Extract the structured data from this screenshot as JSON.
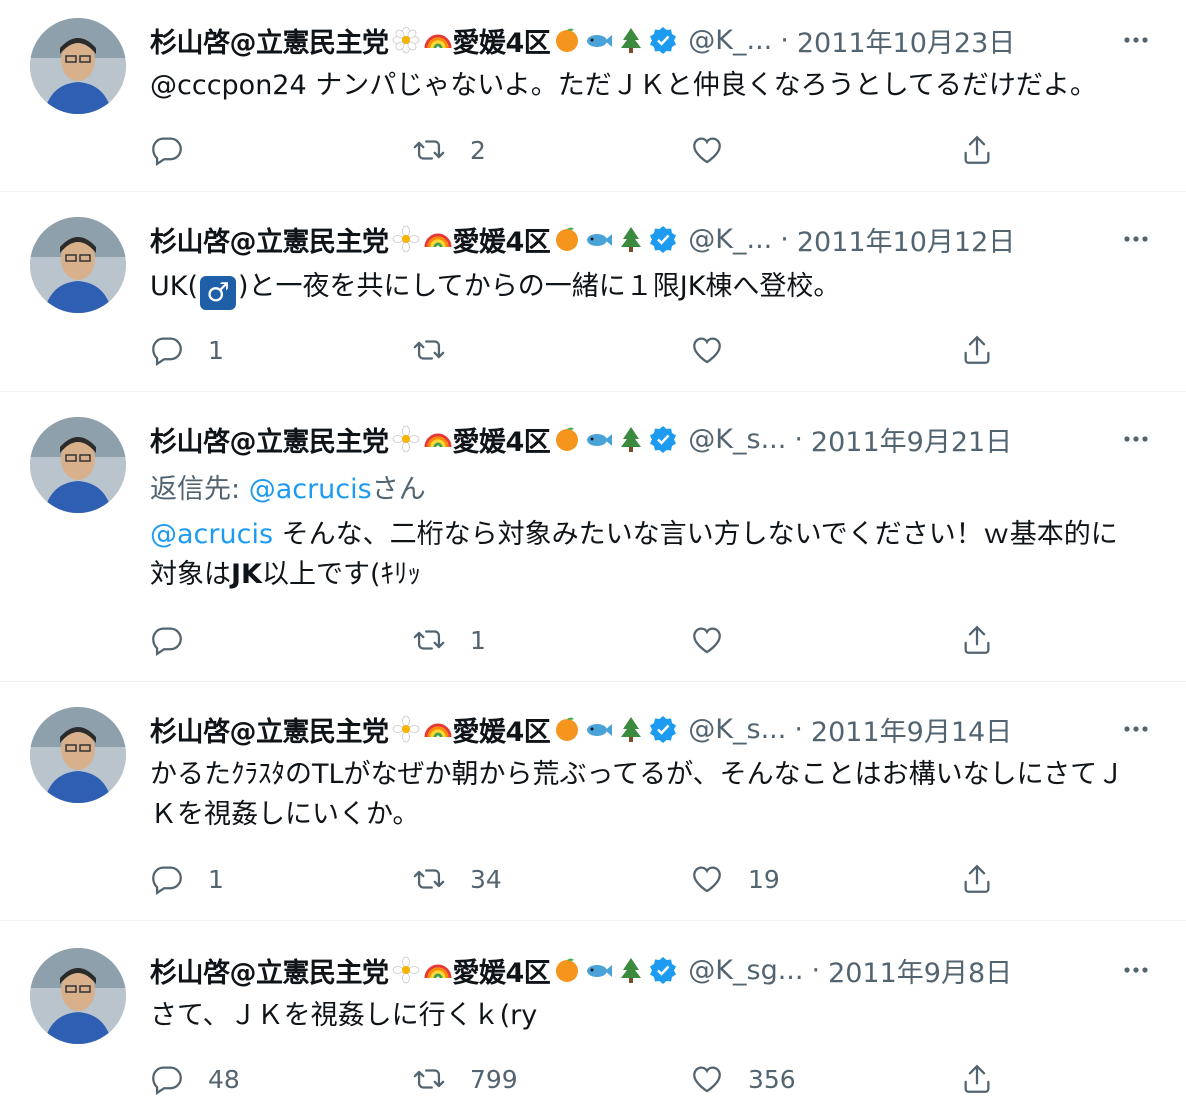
{
  "author": {
    "name": "杉山啓@立憲民主党",
    "emojis": [
      "daisy-icon",
      "rainbow-icon"
    ],
    "suffix": "愛媛4区",
    "suffix_emojis": [
      "orange-icon",
      "fish-icon",
      "tree-icon",
      "verified-badge-icon"
    ]
  },
  "colors": {
    "link": "#1d9bf0",
    "muted": "#536471",
    "verified": "#1d9bf0"
  },
  "tweets": [
    {
      "handle": "@K_...",
      "date": "2011年10月23日",
      "text_parts": [
        "@cccpon24 ナンパじゃないよ。ただＪＫと仲良くなろうとしてるだけだよ。"
      ],
      "reply_count": "",
      "retweet_count": "2",
      "like_count": ""
    },
    {
      "handle": "@K_...",
      "date": "2011年10月12日",
      "text_pre": "UK(",
      "text_symbol": "♂",
      "text_post": ")と一夜を共にしてからの一緒に１限JK棟へ登校。",
      "reply_count": "1",
      "retweet_count": "",
      "like_count": ""
    },
    {
      "handle": "@K_s...",
      "date": "2011年9月21日",
      "reply_label": "返信先: ",
      "reply_handle": "@acrucis",
      "reply_suffix": "さん",
      "mention": "@acrucis",
      "text_line1": " そんな、二桁なら対象みたいな言い方しないでください！ｗ基本的に",
      "text_line2_pre": "対象は",
      "text_line2_bold": "JK",
      "text_line2_post": "以上です(ｷﾘｯ",
      "reply_count": "",
      "retweet_count": "1",
      "like_count": ""
    },
    {
      "handle": "@K_s...",
      "date": "2011年9月14日",
      "text_line1": "かるたｸﾗｽﾀのTLがなぜか朝から荒ぶってるが、そんなことはお構いなしにさてＪ",
      "text_line2": "Ｋを視姦しにいくか。",
      "reply_count": "1",
      "retweet_count": "34",
      "like_count": "19"
    },
    {
      "handle": "@K_sg...",
      "date": "2011年9月8日",
      "text_line1": "さて、ＪＫを視姦しに行くｋ(ry",
      "reply_count": "48",
      "retweet_count": "799",
      "like_count": "356"
    }
  ]
}
